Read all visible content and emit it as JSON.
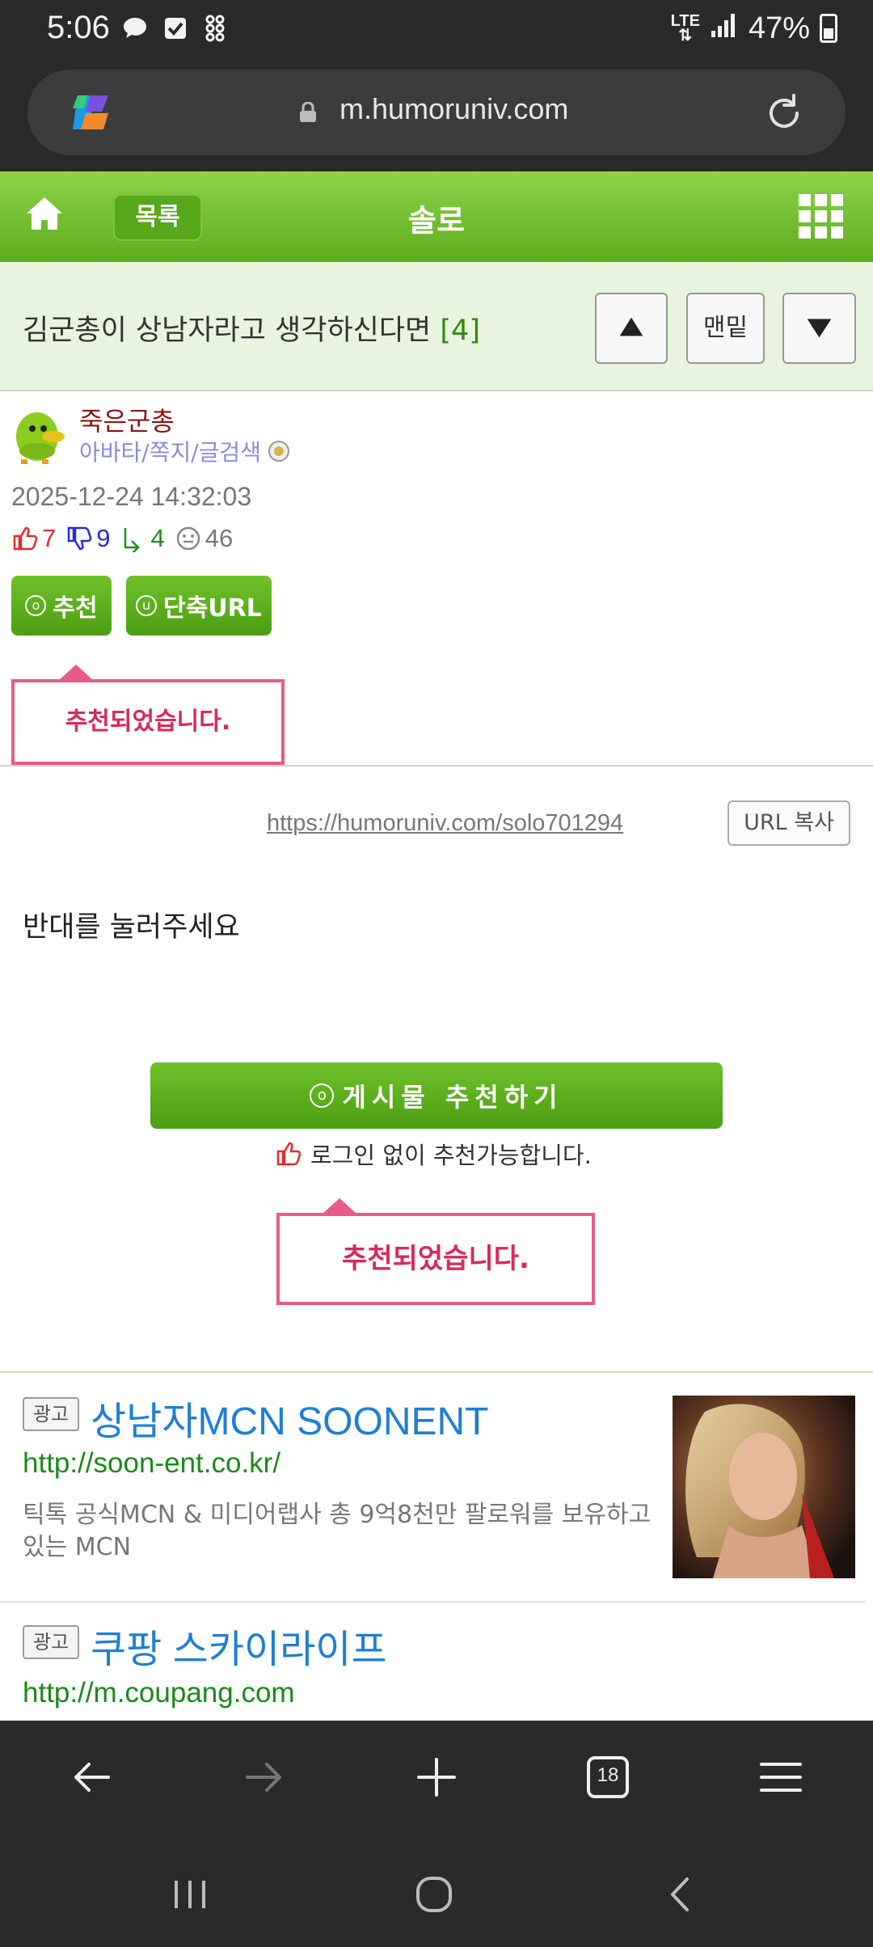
{
  "status_bar": {
    "time": "5:06",
    "network": "LTE",
    "battery": "47%"
  },
  "browser": {
    "url": "m.humoruniv.com"
  },
  "site_header": {
    "list_button": "목록",
    "board_title": "솔로"
  },
  "post": {
    "title": "김군총이 상남자라고 생각하신다면",
    "comment_count": "[4]",
    "nav": {
      "bottom_label": "맨밑"
    },
    "author": "죽은군총",
    "author_links": "아바타/쪽지/글검색",
    "date": "2025-12-24 14:32:03",
    "stats": {
      "upvotes": "7",
      "downvotes": "9",
      "replies": "4",
      "views": "46"
    },
    "recommend_button": "추천",
    "short_url_button": "단축URL",
    "recommended_tip": "추천되었습니다.",
    "post_url": "https://humoruniv.com/solo701294",
    "url_copy_button": "URL 복사",
    "body": "반대를 눌러주세요",
    "big_recommend_button": "게시물  추천하기",
    "no_login_note": "로그인 없이 추천가능합니다.",
    "recommended_tip_2": "추천되었습니다."
  },
  "ads": [
    {
      "label": "광고",
      "title": "상남자MCN SOONENT",
      "url": "http://soon-ent.co.kr/",
      "description": "틱톡 공식MCN & 미디어랩사 총 9억8천만 팔로워를 보유하고있는 MCN"
    },
    {
      "label": "광고",
      "title": "쿠팡 스카이라이프",
      "url": "http://m.coupang.com"
    }
  ],
  "bottom_toolbar": {
    "tab_count": "18"
  },
  "colors": {
    "header_green": "#6dbf2a",
    "title_row_bg": "#e8f4dd",
    "tip_pink": "#e85a87",
    "link_blue": "#1e7fd3",
    "url_green": "#1a8a1a"
  }
}
